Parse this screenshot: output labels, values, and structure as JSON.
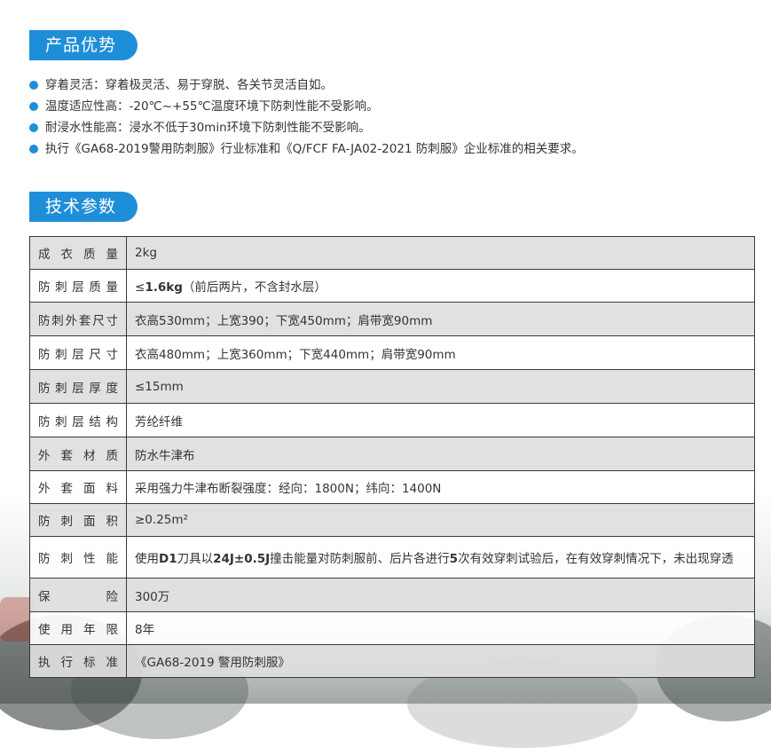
{
  "section_advantages": {
    "title": "产品优势"
  },
  "advantages": [
    "穿着灵活：穿着极灵活、易于穿脱、各关节灵活自如。",
    "温度适应性高：-20℃~+55℃温度环境下防刺性能不受影响。",
    "耐浸水性能高：浸水不低于30min环境下防刺性能不受影响。",
    "执行《GA68-2019警用防刺服》行业标准和《Q/FCF FA-JA02-2021 防刺服》企业标准的相关要求。"
  ],
  "section_specs": {
    "title": "技术参数"
  },
  "specs": [
    {
      "label": "成衣质量",
      "value": "2kg"
    },
    {
      "label": "防刺层质量",
      "value_parts": [
        "≤",
        "1.6kg",
        "（前后两片，不含封水层）"
      ]
    },
    {
      "label": "防刺外套尺寸",
      "value": "衣高530mm；上宽390；下宽450mm；肩带宽90mm"
    },
    {
      "label": "防刺层尺寸",
      "value": "衣高480mm；上宽360mm；下宽440mm；肩带宽90mm"
    },
    {
      "label": "防刺层厚度",
      "value": "≤15mm"
    },
    {
      "label": "防刺层结构",
      "value": "芳纶纤维"
    },
    {
      "label": "外套材质",
      "value": "防水牛津布"
    },
    {
      "label": "外套面料",
      "value": "采用强力牛津布断裂强度：经向：1800N；纬向：1400N"
    },
    {
      "label": "防刺面积",
      "value": "≥0.25m²"
    },
    {
      "label": "防刺性能",
      "value_parts": [
        "使用",
        "D1",
        "刀具以",
        "24J±0.5J",
        "撞击能量对防刺服前、后片各进行",
        "5",
        "次有效穿刺试验后，在有效穿刺情况下，未出现穿透"
      ]
    },
    {
      "label": "保险",
      "value": "300万"
    },
    {
      "label": "使用年限",
      "value": "8年"
    },
    {
      "label": "执行标准",
      "value": "《GA68-2019 警用防刺服》"
    }
  ]
}
